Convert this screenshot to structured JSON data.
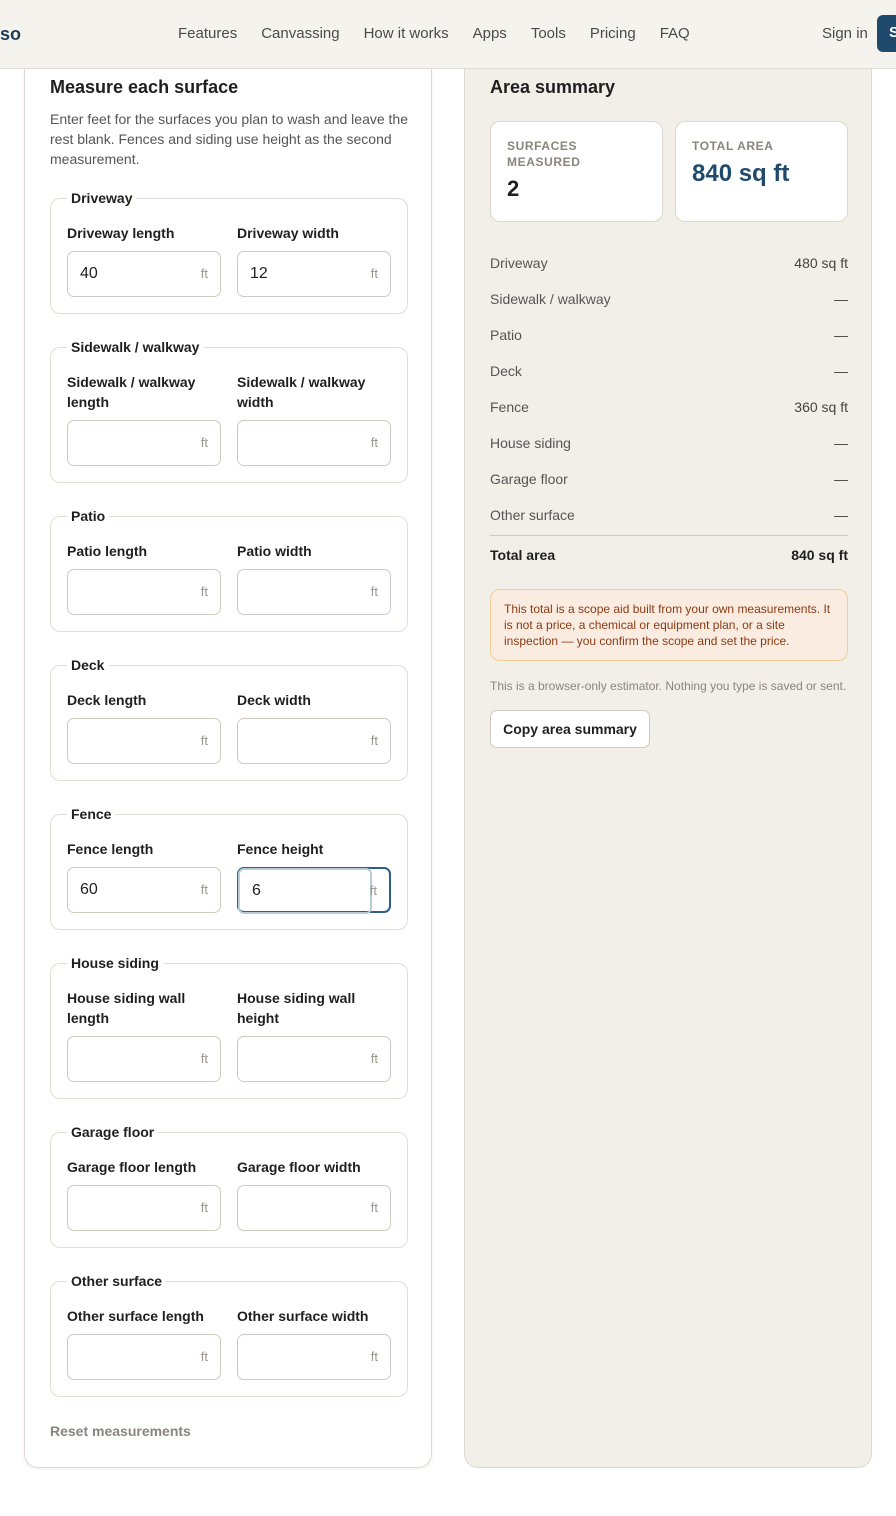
{
  "header": {
    "logo_text": "so",
    "nav": [
      "Features",
      "Canvassing",
      "How it works",
      "Apps",
      "Tools",
      "Pricing",
      "FAQ"
    ],
    "signin_label": "Sign in",
    "cta_label": "S"
  },
  "form": {
    "title": "Measure each surface",
    "description": "Enter feet for the surfaces you plan to wash and leave the rest blank. Fences and siding use height as the second measurement.",
    "unit": "ft",
    "groups": [
      {
        "legend": "Driveway",
        "f1_label": "Driveway length",
        "f1_value": "40",
        "f2_label": "Driveway width",
        "f2_value": "12"
      },
      {
        "legend": "Sidewalk / walkway",
        "f1_label": "Sidewalk / walkway length",
        "f1_value": "",
        "f2_label": "Sidewalk / walkway width",
        "f2_value": ""
      },
      {
        "legend": "Patio",
        "f1_label": "Patio length",
        "f1_value": "",
        "f2_label": "Patio width",
        "f2_value": ""
      },
      {
        "legend": "Deck",
        "f1_label": "Deck length",
        "f1_value": "",
        "f2_label": "Deck width",
        "f2_value": ""
      },
      {
        "legend": "Fence",
        "f1_label": "Fence length",
        "f1_value": "60",
        "f2_label": "Fence height",
        "f2_value": "6"
      },
      {
        "legend": "House siding",
        "f1_label": "House siding wall length",
        "f1_value": "",
        "f2_label": "House siding wall height",
        "f2_value": ""
      },
      {
        "legend": "Garage floor",
        "f1_label": "Garage floor length",
        "f1_value": "",
        "f2_label": "Garage floor width",
        "f2_value": ""
      },
      {
        "legend": "Other surface",
        "f1_label": "Other surface length",
        "f1_value": "",
        "f2_label": "Other surface width",
        "f2_value": ""
      }
    ],
    "reset_label": "Reset measurements"
  },
  "summary": {
    "title": "Area summary",
    "surfaces_label": "SURFACES MEASURED",
    "surfaces_value": "2",
    "total_label": "TOTAL AREA",
    "total_value": "840 sq ft",
    "rows": [
      {
        "name": "Driveway",
        "value": "480 sq ft"
      },
      {
        "name": "Sidewalk / walkway",
        "value": "—"
      },
      {
        "name": "Patio",
        "value": "—"
      },
      {
        "name": "Deck",
        "value": "—"
      },
      {
        "name": "Fence",
        "value": "360 sq ft"
      },
      {
        "name": "House siding",
        "value": "—"
      },
      {
        "name": "Garage floor",
        "value": "—"
      },
      {
        "name": "Other surface",
        "value": "—"
      }
    ],
    "total_row_label": "Total area",
    "total_row_value": "840 sq ft",
    "notice": "This total is a scope aid built from your own measurements. It is not a price, a chemical or equipment plan, or a site inspection — you confirm the scope and set the price.",
    "note": "This is a browser-only estimator. Nothing you type is saved or sent.",
    "copy_label": "Copy area summary"
  },
  "colors": {
    "accent": "#1f4a6e",
    "notice_bg": "#fbece2",
    "notice_text": "#8a3a12",
    "panel_bg": "#f2efe8"
  }
}
